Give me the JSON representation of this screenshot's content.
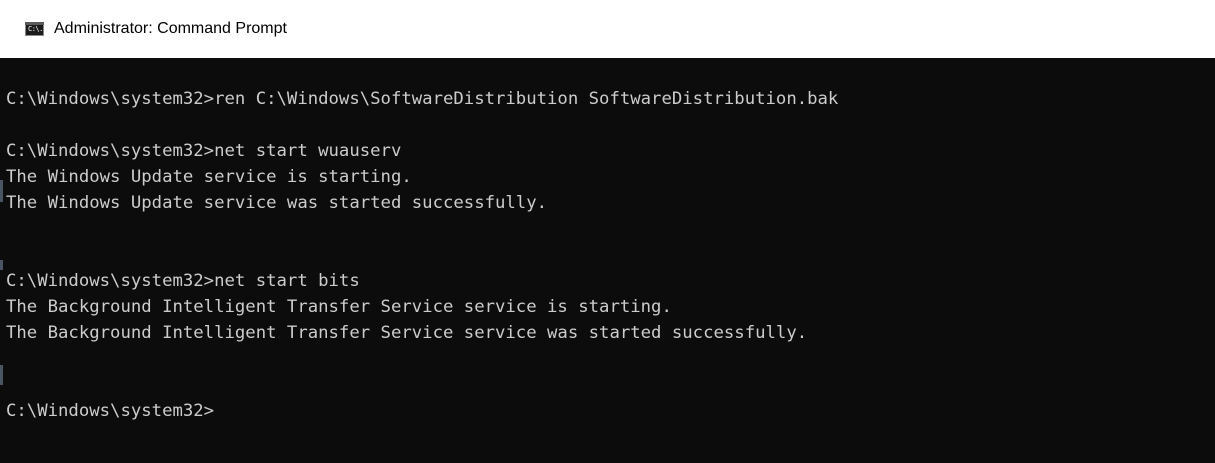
{
  "window": {
    "title": "Administrator: Command Prompt",
    "icon": "command-prompt-icon",
    "icon_text": "C:\\."
  },
  "console": {
    "lines": [
      "C:\\Windows\\system32>ren C:\\Windows\\SoftwareDistribution SoftwareDistribution.bak",
      "",
      "C:\\Windows\\system32>net start wuauserv",
      "The Windows Update service is starting.",
      "The Windows Update service was started successfully.",
      "",
      "",
      "C:\\Windows\\system32>net start bits",
      "The Background Intelligent Transfer Service service is starting.",
      "The Background Intelligent Transfer Service service was started successfully.",
      "",
      "",
      "C:\\Windows\\system32>"
    ]
  },
  "colors": {
    "console_background": "#0c0c0c",
    "console_text": "#cccccc",
    "titlebar_background": "#ffffff",
    "title_text": "#000000"
  }
}
